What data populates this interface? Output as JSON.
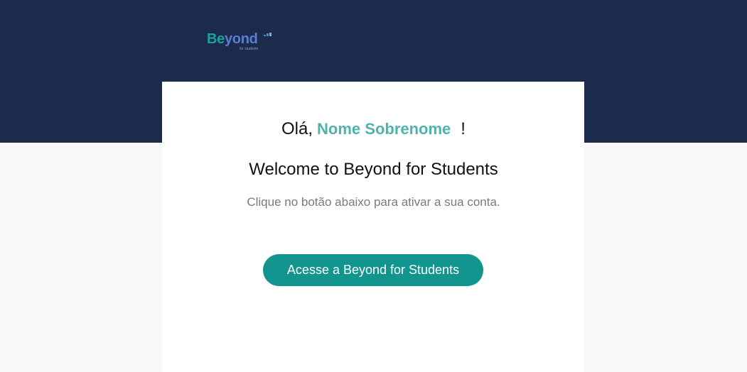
{
  "brand": {
    "logo_part1": "Be",
    "logo_part2": "yond",
    "logo_sub": "for students",
    "colors": {
      "header": "#1c2a4b",
      "accent": "#4db3ad",
      "button": "#12958f",
      "page_bg": "#f8f8f8",
      "card_bg": "#ffffff"
    }
  },
  "greeting": {
    "prefix": "Olá,",
    "name": "Nome Sobrenome",
    "suffix": "!"
  },
  "welcome_title": "Welcome to Beyond for Students",
  "subtitle": "Clique no botão abaixo para ativar a sua conta.",
  "cta_label": "Acesse a Beyond for Students"
}
